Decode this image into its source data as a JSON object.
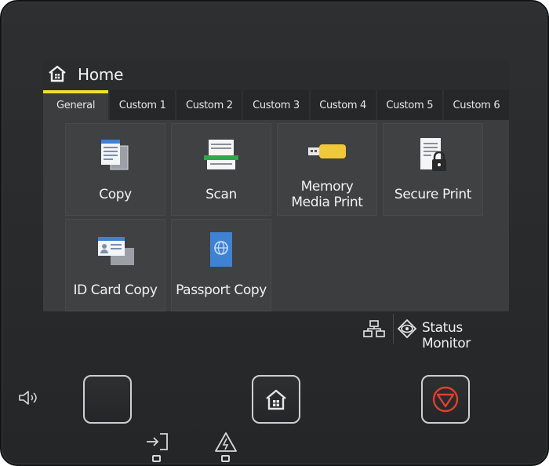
{
  "screen": {
    "title": "Home",
    "tabs": [
      {
        "label": "General",
        "active": true
      },
      {
        "label": "Custom 1",
        "active": false
      },
      {
        "label": "Custom 2",
        "active": false
      },
      {
        "label": "Custom 3",
        "active": false
      },
      {
        "label": "Custom 4",
        "active": false
      },
      {
        "label": "Custom 5",
        "active": false
      },
      {
        "label": "Custom 6",
        "active": false
      }
    ],
    "tiles": {
      "copy": "Copy",
      "scan": "Scan",
      "memory_line1": "Memory",
      "memory_line2": "Media Print",
      "secure_print": "Secure Print",
      "id_card_copy": "ID Card Copy",
      "passport_copy": "Passport Copy"
    },
    "status_monitor": "Status Monitor"
  },
  "colors": {
    "active_tab_accent": "#f2e02a",
    "stop_button": "#e0402a",
    "usb_stick": "#f0c93a",
    "scanner_green": "#2fa84a",
    "passport_blue": "#3f82d4"
  },
  "icons": {
    "title": "home-icon",
    "copy": "copy-icon",
    "scan": "scan-icon",
    "memory": "usb-memory-icon",
    "secure_print": "lock-document-icon",
    "id_card": "id-card-icon",
    "passport": "passport-icon",
    "network": "network-icon",
    "status": "eye-icon",
    "energy_saver": "moon-icon",
    "home_key": "home-icon",
    "stop_key": "stop-icon",
    "volume": "speaker-icon",
    "data_led": "data-in-icon",
    "error_led": "warning-icon"
  }
}
